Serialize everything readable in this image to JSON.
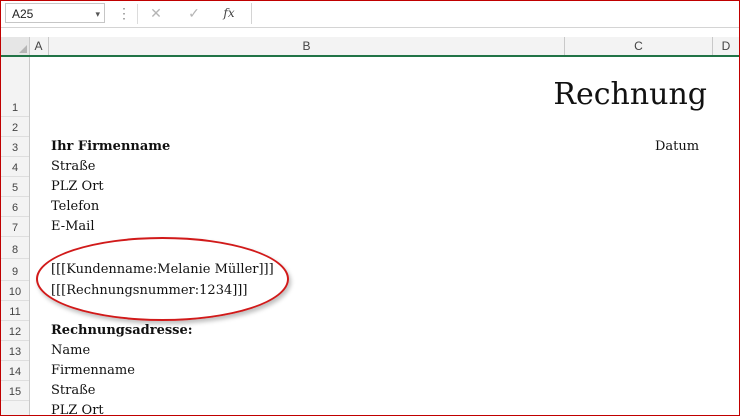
{
  "formula_bar": {
    "name_box": "A25",
    "name_box_dropdown": "▾",
    "more_glyph": "⋮",
    "cancel_glyph": "✕",
    "enter_glyph": "✓",
    "fx_label": "fx",
    "formula": ""
  },
  "columns": [
    "A",
    "B",
    "C",
    "D"
  ],
  "rows": [
    "1",
    "2",
    "3",
    "4",
    "5",
    "6",
    "7",
    "8",
    "9",
    "10",
    "11",
    "12",
    "13",
    "14",
    "15"
  ],
  "sheet": {
    "title": "Rechnung",
    "company": "Ihr Firmenname",
    "date_label": "Datum",
    "street": "Straße",
    "plz_ort": "PLZ Ort",
    "phone": "Telefon",
    "email": "E-Mail",
    "placeholder_customer": "[[[Kundenname:Melanie Müller]]]",
    "placeholder_invoice": "[[[Rechnungsnummer:1234]]]",
    "billing_heading": "Rechnungsadresse:",
    "billing_name": "Name",
    "billing_company": "Firmenname",
    "billing_street": "Straße",
    "billing_plz_ort": "PLZ Ort"
  },
  "highlight_color": "#d11a1a",
  "accent_color": "#217346"
}
